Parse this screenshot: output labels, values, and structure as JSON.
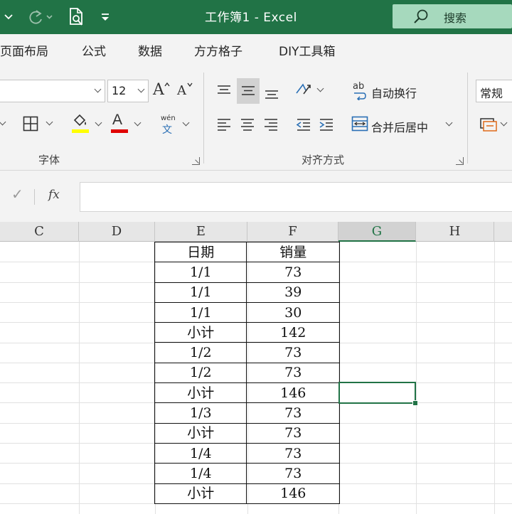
{
  "colors": {
    "accent": "#217346",
    "search_bg": "#a6d9bd",
    "ribbon_bg": "#f3f3f3"
  },
  "titlebar": {
    "title": "工作簿1  -  Excel",
    "search_label": "搜索",
    "icons": [
      "undo-dropdown-icon",
      "redo-icon",
      "print-preview-icon",
      "customize-quick-access-icon",
      "search-icon"
    ]
  },
  "tabs": [
    "页面布局",
    "公式",
    "数据",
    "方方格子",
    "DIY工具箱"
  ],
  "ribbon": {
    "font_group": {
      "label": "字体",
      "font_size": "12",
      "grow_label": "A",
      "shrink_label": "A",
      "font_color_letter": "A",
      "phonetic_top": "wén",
      "phonetic_bottom": "文",
      "highlight_color": "#ffff00",
      "font_color": "#e00000"
    },
    "align_group": {
      "label": "对齐方式",
      "wrap_text": "自动换行",
      "merge_center": "合并后居中",
      "wrap_icon_text": "ab"
    },
    "number_group": {
      "format": "常规"
    }
  },
  "formula_bar": {
    "check": "✓",
    "fx": "fx",
    "value": ""
  },
  "columns": [
    "C",
    "D",
    "E",
    "F",
    "G",
    "H"
  ],
  "table": {
    "headers": [
      "日期",
      "销量"
    ],
    "rows": [
      [
        "1/1",
        "73"
      ],
      [
        "1/1",
        "39"
      ],
      [
        "1/1",
        "30"
      ],
      [
        "小计",
        "142"
      ],
      [
        "1/2",
        "73"
      ],
      [
        "1/2",
        "73"
      ],
      [
        "小计",
        "146"
      ],
      [
        "1/3",
        "73"
      ],
      [
        "小计",
        "73"
      ],
      [
        "1/4",
        "73"
      ],
      [
        "1/4",
        "73"
      ],
      [
        "小计",
        "146"
      ]
    ]
  }
}
